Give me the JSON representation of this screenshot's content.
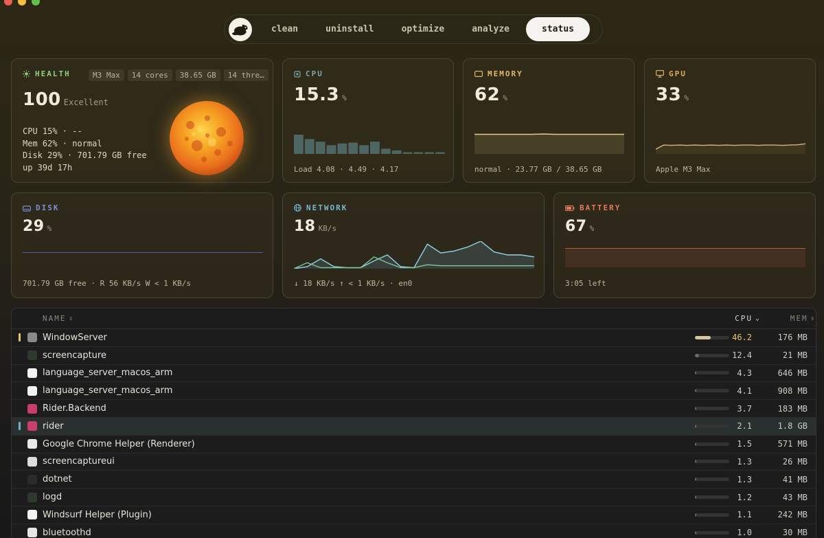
{
  "nav": {
    "tabs": [
      {
        "label": "clean",
        "active": false
      },
      {
        "label": "uninstall",
        "active": false
      },
      {
        "label": "optimize",
        "active": false
      },
      {
        "label": "analyze",
        "active": false
      },
      {
        "label": "status",
        "active": true
      }
    ]
  },
  "health": {
    "label": "HEALTH",
    "chips": [
      "M3 Max",
      "14 cores",
      "38.65 GB",
      "14 thre…"
    ],
    "score": "100",
    "rating": "Excellent",
    "lines": [
      "CPU 15% · --",
      "Mem 62% · normal",
      "Disk 29% · 701.79 GB free",
      "up 39d 17h"
    ]
  },
  "cpu": {
    "label": "CPU",
    "value": "15.3",
    "unit": "%",
    "footer": "Load 4.08 · 4.49 · 4.17",
    "history": [
      22,
      17,
      14,
      10,
      12,
      13,
      10,
      14,
      6,
      4,
      2,
      2,
      2,
      2
    ]
  },
  "memory": {
    "label": "MEMORY",
    "value": "62",
    "unit": "%",
    "footer": "normal · 23.77 GB / 38.65 GB",
    "history": [
      62,
      62,
      62,
      62,
      62,
      62,
      63,
      62,
      62,
      62,
      62,
      62,
      62,
      62
    ]
  },
  "gpu": {
    "label": "GPU",
    "value": "33",
    "unit": "%",
    "footer": "Apple M3 Max",
    "history": [
      15,
      28,
      27,
      28,
      27,
      28,
      27,
      28,
      27,
      28,
      27,
      28,
      28,
      27,
      28,
      28,
      27,
      28,
      29,
      32
    ]
  },
  "disk": {
    "label": "DISK",
    "value": "29",
    "unit": "%",
    "footer": "701.79 GB free · R 56 KB/s W < 1 KB/s",
    "history": [
      29,
      29,
      29,
      29,
      29,
      29,
      29,
      29,
      29,
      29
    ]
  },
  "network": {
    "label": "NETWORK",
    "value": "18",
    "unit": "KB/s",
    "footer": "↓ 18 KB/s  ↑ < 1 KB/s · en0",
    "rx": [
      0,
      2,
      10,
      2,
      1,
      1,
      8,
      14,
      2,
      1,
      25,
      16,
      18,
      22,
      28,
      17,
      14,
      14,
      12
    ],
    "tx": [
      0,
      6,
      1,
      1,
      1,
      1,
      12,
      6,
      1,
      1,
      4,
      3,
      3,
      3,
      3,
      3,
      3,
      3,
      3
    ]
  },
  "battery": {
    "label": "BATTERY",
    "value": "67",
    "unit": "%",
    "footer": "3:05 left",
    "history": [
      67,
      67,
      67,
      67,
      67,
      67,
      67,
      67,
      67,
      67
    ]
  },
  "table": {
    "headers": {
      "name": "NAME",
      "cpu": "CPU",
      "mem": "MEM"
    },
    "rows": [
      {
        "name": "WindowServer",
        "cpu": "46.2",
        "mem": "176 MB",
        "icon": "windowserver-icon",
        "color": "#8a8a8a",
        "marker": "#e9c46a",
        "highlight": true,
        "selected": false
      },
      {
        "name": "screencapture",
        "cpu": "12.4",
        "mem": "21 MB",
        "icon": "activity-icon",
        "color": "#2f3a2f",
        "marker": "",
        "highlight": false,
        "selected": false
      },
      {
        "name": "language_server_macos_arm",
        "cpu": "4.3",
        "mem": "646 MB",
        "icon": "windsurf-icon",
        "color": "#f2f2f2",
        "marker": "",
        "highlight": false,
        "selected": false
      },
      {
        "name": "language_server_macos_arm",
        "cpu": "4.1",
        "mem": "908 MB",
        "icon": "windsurf-icon",
        "color": "#f2f2f2",
        "marker": "",
        "highlight": false,
        "selected": false
      },
      {
        "name": "Rider.Backend",
        "cpu": "3.7",
        "mem": "183 MB",
        "icon": "rider-icon",
        "color": "#c7406d",
        "marker": "",
        "highlight": false,
        "selected": false
      },
      {
        "name": "rider",
        "cpu": "2.1",
        "mem": "1.8 GB",
        "icon": "rider-icon",
        "color": "#c7406d",
        "marker": "#6fb3c9",
        "highlight": false,
        "selected": true
      },
      {
        "name": "Google Chrome Helper (Renderer)",
        "cpu": "1.5",
        "mem": "571 MB",
        "icon": "chrome-icon",
        "color": "#e8e8e8",
        "marker": "",
        "highlight": false,
        "selected": false
      },
      {
        "name": "screencaptureui",
        "cpu": "1.3",
        "mem": "26 MB",
        "icon": "generic-app-icon",
        "color": "#dcdcdc",
        "marker": "",
        "highlight": false,
        "selected": false
      },
      {
        "name": "dotnet",
        "cpu": "1.3",
        "mem": "41 MB",
        "icon": "terminal-icon",
        "color": "#2b2b2b",
        "marker": "",
        "highlight": false,
        "selected": false
      },
      {
        "name": "logd",
        "cpu": "1.2",
        "mem": "43 MB",
        "icon": "activity-icon",
        "color": "#2f3a2f",
        "marker": "",
        "highlight": false,
        "selected": false
      },
      {
        "name": "Windsurf Helper (Plugin)",
        "cpu": "1.1",
        "mem": "242 MB",
        "icon": "windsurf-icon",
        "color": "#f2f2f2",
        "marker": "",
        "highlight": false,
        "selected": false
      },
      {
        "name": "bluetoothd",
        "cpu": "1.0",
        "mem": "30 MB",
        "icon": "document-icon",
        "color": "#e6e6e6",
        "marker": "",
        "highlight": false,
        "selected": false
      }
    ]
  }
}
